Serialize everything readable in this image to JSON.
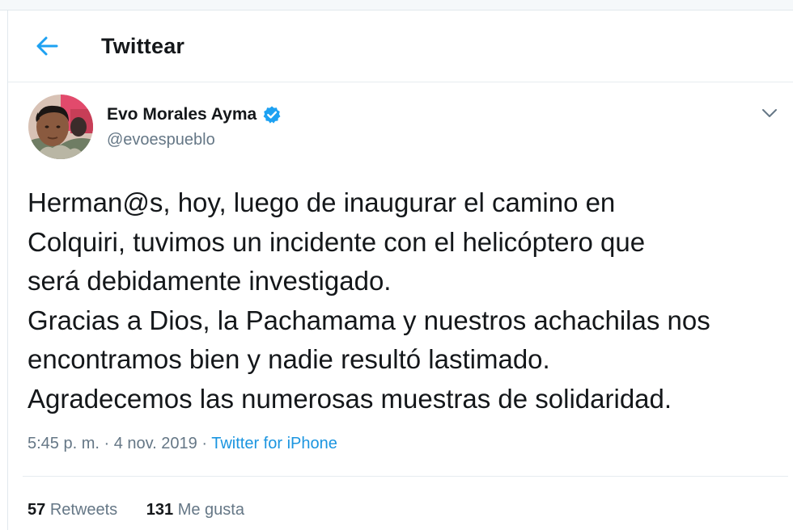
{
  "header": {
    "title": "Twittear",
    "back_icon": "arrow-left-icon",
    "accent_color": "#1da1f2"
  },
  "author": {
    "name": "Evo Morales Ayma",
    "handle": "@evoespueblo",
    "verified_icon": "verified-badge-icon"
  },
  "tweet": {
    "lines": [
      "Herman@s, hoy, luego de inaugurar el camino en",
      "Colquiri, tuvimos un incidente con el helicóptero que",
      "será debidamente investigado.",
      "Gracias a Dios, la Pachamama y nuestros achachilas nos",
      "encontramos bien y nadie resultó lastimado.",
      "Agradecemos las numerosas muestras de solidaridad."
    ],
    "time": "5:45 p. m.",
    "separator": "·",
    "date": "4 nov. 2019",
    "source": "Twitter for iPhone"
  },
  "stats": {
    "retweets_count": "57",
    "retweets_label": "Retweets",
    "likes_count": "131",
    "likes_label": "Me gusta"
  },
  "menu": {
    "caret_icon": "chevron-down-icon"
  }
}
